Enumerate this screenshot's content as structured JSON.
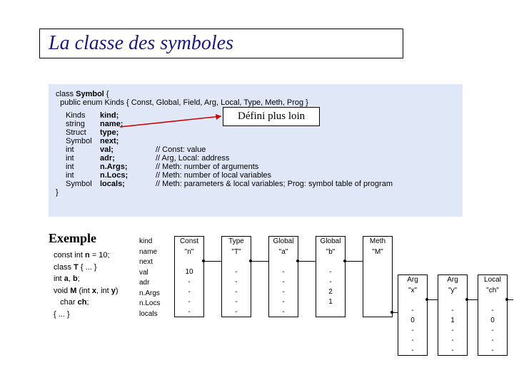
{
  "title": "La classe des symboles",
  "class_decl": {
    "header": "class Symbol {",
    "enum_line": "  public enum Kinds { Const, Global, Field, Arg, Local, Type, Meth, Prog }",
    "fields": [
      {
        "type": "Kinds",
        "name": "kind;",
        "comment": ""
      },
      {
        "type": "string",
        "name": "name;",
        "comment": ""
      },
      {
        "type": "Struct",
        "name": "type;",
        "comment": ""
      },
      {
        "type": "Symbol",
        "name": "next;",
        "comment": ""
      },
      {
        "type": "int",
        "name": "val;",
        "comment": "// Const: value"
      },
      {
        "type": "int",
        "name": "adr;",
        "comment": "// Arg, Local: address"
      },
      {
        "type": "int",
        "name": "n.Args;",
        "comment": "// Meth: number of arguments"
      },
      {
        "type": "int",
        "name": "n.Locs;",
        "comment": "// Meth: number of local variables"
      },
      {
        "type": "Symbol",
        "name": "locals;",
        "comment": "// Meth: parameters & local variables; Prog: symbol table of program"
      }
    ],
    "footer": "}"
  },
  "defini": "Défini plus loin",
  "exemple": {
    "title": "Exemple",
    "lines": [
      {
        "pre": "const int ",
        "b": "n",
        "post": " = 10;"
      },
      {
        "pre": "class ",
        "b": "T",
        "post": " { ... }"
      },
      {
        "pre": "int ",
        "b": "a",
        "post": ", ",
        "b2": "b",
        "post2": ";"
      },
      {
        "pre": "void ",
        "b": "M",
        "post": " (int ",
        "b2": "x",
        "post2": ", int ",
        "b3": "y",
        "post3": ")"
      },
      {
        "pre": "   char ",
        "b": "ch",
        "post": ";"
      },
      {
        "pre": "{ ... }",
        "b": "",
        "post": ""
      }
    ]
  },
  "field_labels": [
    "kind",
    "name",
    "next",
    "val",
    "adr",
    "n.Args",
    "n.Locs",
    "locals"
  ],
  "nodes_top": [
    {
      "kind": "Const",
      "name": "\"n\"",
      "val": "10",
      "adr": "-",
      "nA": "-",
      "nL": "-",
      "loc": "-"
    },
    {
      "kind": "Type",
      "name": "\"T\"",
      "val": "-",
      "adr": "-",
      "nA": "-",
      "nL": "-",
      "loc": "-"
    },
    {
      "kind": "Global",
      "name": "\"a\"",
      "val": "-",
      "adr": "-",
      "nA": "-",
      "nL": "-",
      "loc": "-"
    },
    {
      "kind": "Global",
      "name": "\"b\"",
      "val": "-",
      "adr": "-",
      "nA": "2",
      "nL": "1",
      "loc": ""
    },
    {
      "kind": "Meth",
      "name": "\"M\"",
      "val": "-",
      "adr": "-",
      "nA": "",
      "nL": "",
      "loc": ""
    }
  ],
  "nodes_bottom": [
    {
      "kind": "Arg",
      "name": "\"x\"",
      "val": "-",
      "adr": "0",
      "nA": "-",
      "nL": "-",
      "loc": "-"
    },
    {
      "kind": "Arg",
      "name": "\"y\"",
      "val": "-",
      "adr": "1",
      "nA": "-",
      "nL": "-",
      "loc": "-"
    },
    {
      "kind": "Local",
      "name": "\"ch\"",
      "val": "-",
      "adr": "0",
      "nA": "-",
      "nL": "-",
      "loc": "-"
    }
  ]
}
